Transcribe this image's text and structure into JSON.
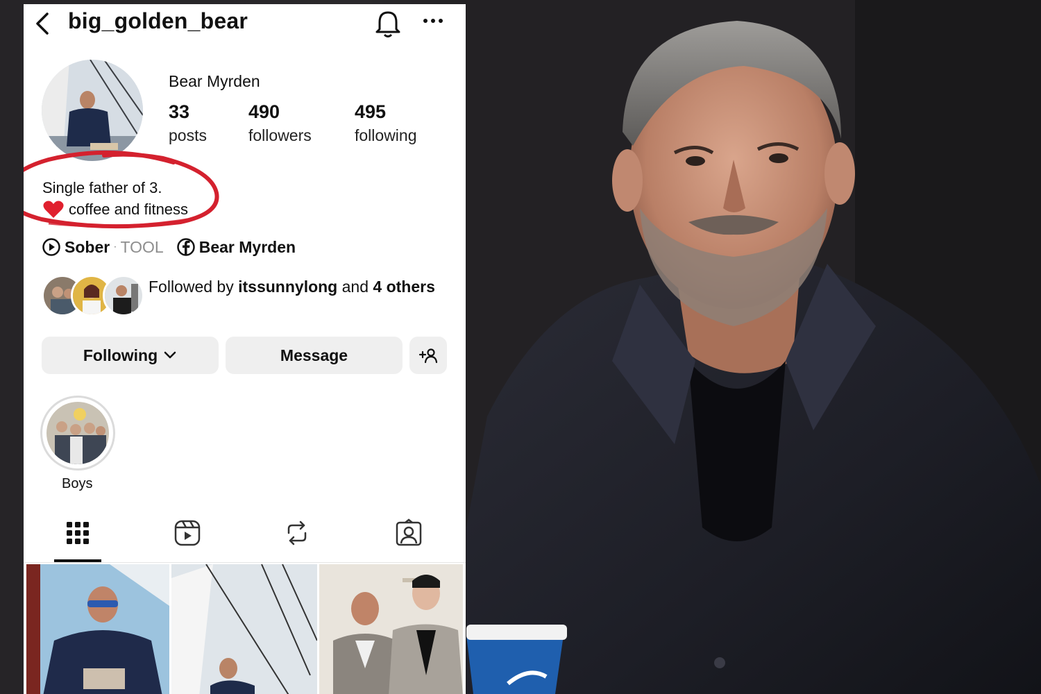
{
  "header": {
    "username": "big_golden_bear"
  },
  "profile": {
    "display_name": "Bear Myrden",
    "stats": [
      {
        "value": "33",
        "label": "posts"
      },
      {
        "value": "490",
        "label": "followers"
      },
      {
        "value": "495",
        "label": "following"
      }
    ],
    "bio_line1": "Single father of 3.",
    "bio_line2": "coffee and fitness",
    "music_title": "Sober",
    "music_separator": "·",
    "music_artist": "TOOL",
    "facebook_name": "Bear Myrden"
  },
  "followed_by": {
    "prefix": "Followed by ",
    "user": "itssunnylong",
    "middle": " and ",
    "count_text": "4 others"
  },
  "actions": {
    "following_label": "Following",
    "message_label": "Message"
  },
  "highlights": [
    {
      "label": "Boys"
    }
  ],
  "tabs": [
    "grid",
    "reels",
    "reposts",
    "tagged"
  ],
  "colors": {
    "annotation_red": "#d4212e",
    "button_bg": "#efefef",
    "cup_blue": "#1f5fae"
  }
}
